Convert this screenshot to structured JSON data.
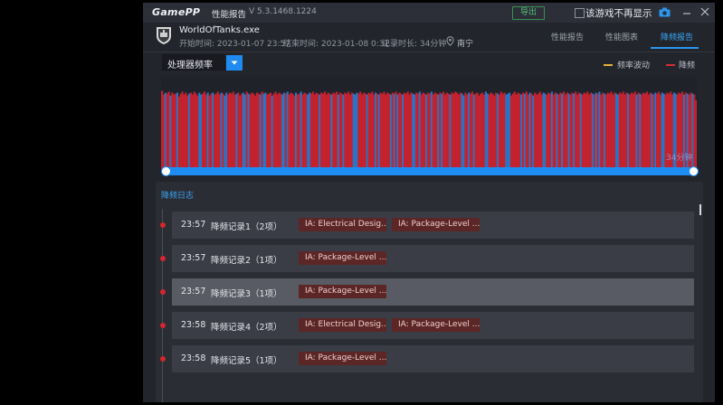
{
  "window": {
    "logo": "GamePP",
    "title": "性能报告",
    "version": "V 5.3.1468.1224",
    "export_label": "导出",
    "no_show_label": "该游戏不再显示"
  },
  "header": {
    "exe_name": "WorldOfTanks.exe",
    "start_time": "开始时间: 2023-01-07 23:57",
    "end_time": "结束时间: 2023-01-08 0:31",
    "duration": "记录时长: 34分钟",
    "city": "南宁",
    "tabs": [
      {
        "label": "性能报告",
        "active": false
      },
      {
        "label": "性能图表",
        "active": false
      },
      {
        "label": "降频报告",
        "active": true
      }
    ]
  },
  "chart_controls": {
    "metric_select": "处理器频率",
    "legend": [
      {
        "label": "频率波动",
        "color": "#e3b23a"
      },
      {
        "label": "降频",
        "color": "#d03036"
      }
    ]
  },
  "chart_data": {
    "type": "bar",
    "title": "",
    "xlabel": "",
    "ylabel": "",
    "duration_label": "34分钟",
    "series": [
      {
        "name": "频率波动",
        "color": "#2c73c4"
      },
      {
        "name": "降频",
        "color": "#c2232e"
      }
    ],
    "values": [
      0.82,
      0.78,
      0.8,
      0.79,
      0.81,
      0.77,
      0.8,
      0.78,
      0.79,
      0.8,
      0.76,
      0.79,
      0.81,
      0.78,
      0.8,
      0.77,
      0.79,
      0.8,
      0.78,
      0.81,
      0.79,
      0.77,
      0.8,
      0.78,
      0.79,
      0.81,
      0.78,
      0.8,
      0.77,
      0.79,
      0.8,
      0.78,
      0.79,
      0.81,
      0.78,
      0.8,
      0.79,
      0.77,
      0.8,
      0.78,
      0.8,
      0.79,
      0.81,
      0.78,
      0.79,
      0.8,
      0.77,
      0.79,
      0.8,
      0.78,
      0.81,
      0.79,
      0.78,
      0.8,
      0.79,
      0.77,
      0.8,
      0.79,
      0.78,
      0.81,
      0.79,
      0.8,
      0.78,
      0.79,
      0.8,
      0.77,
      0.79,
      0.81,
      0.78,
      0.8,
      0.79,
      0.78,
      0.8,
      0.79,
      0.81,
      0.78,
      0.8,
      0.79,
      0.77,
      0.8,
      0.78,
      0.79,
      0.81,
      0.78,
      0.8,
      0.79,
      0.78,
      0.8,
      0.79,
      0.81,
      0.78,
      0.8,
      0.79,
      0.78,
      0.8,
      0.79,
      0.81,
      0.78,
      0.8,
      0.79,
      0.78,
      0.8,
      0.79,
      0.81,
      0.78,
      0.8,
      0.79,
      0.78,
      0.8,
      0.79,
      0.81,
      0.78,
      0.8,
      0.79,
      0.78,
      0.8,
      0.79,
      0.81,
      0.78,
      0.8,
      0.79,
      0.78,
      0.8,
      0.79,
      0.81,
      0.78,
      0.8,
      0.79,
      0.78,
      0.8,
      0.79,
      0.81,
      0.78,
      0.8,
      0.79,
      0.78,
      0.8,
      0.79,
      0.81,
      0.78,
      0.8,
      0.79,
      0.78,
      0.8,
      0.79,
      0.81,
      0.78,
      0.8,
      0.79,
      0.78,
      0.8,
      0.79,
      0.81,
      0.78,
      0.8,
      0.79,
      0.78,
      0.8,
      0.79,
      0.81,
      0.78,
      0.8,
      0.79,
      0.78,
      0.8,
      0.79,
      0.81,
      0.78,
      0.8,
      0.79,
      0.78,
      0.8,
      0.79,
      0.81,
      0.8,
      0.78,
      0.8,
      0.79,
      0.77,
      0.8,
      0.78,
      0.8,
      0.79,
      0.81,
      0.78,
      0.79,
      0.8,
      0.77,
      0.79,
      0.8,
      0.78,
      0.81,
      0.79,
      0.78,
      0.8,
      0.79,
      0.77,
      0.8,
      0.79,
      0.78,
      0.81,
      0.79,
      0.8,
      0.78,
      0.79,
      0.8,
      0.77,
      0.79,
      0.81,
      0.78,
      0.8,
      0.79,
      0.78,
      0.8,
      0.79,
      0.81,
      0.78,
      0.8,
      0.79,
      0.77,
      0.8,
      0.78,
      0.79,
      0.81,
      0.78,
      0.8,
      0.79,
      0.78,
      0.8,
      0.79,
      0.81,
      0.78,
      0.8,
      0.79,
      0.78,
      0.8,
      0.79,
      0.81,
      0.78,
      0.8,
      0.79,
      0.78,
      0.8,
      0.79,
      0.81,
      0.78,
      0.8,
      0.79,
      0.78,
      0.8,
      0.79,
      0.81,
      0.78,
      0.8,
      0.79,
      0.78,
      0.8,
      0.79,
      0.81,
      0.78,
      0.8,
      0.79,
      0.78,
      0.8,
      0.79,
      0.81,
      0.78,
      0.8,
      0.79,
      0.78,
      0.8,
      0.79,
      0.81,
      0.78,
      0.8,
      0.79,
      0.78,
      0.8,
      0.79,
      0.81,
      0.78,
      0.8,
      0.79,
      0.78,
      0.8,
      0.79,
      0.81,
      0.78,
      0.8,
      0.79,
      0.78,
      0.8,
      0.79,
      0.81,
      0.78,
      0.8,
      0.79,
      0.78,
      0.8,
      0.79,
      0.81,
      0.78,
      0.8,
      0.79,
      0.78,
      0.8,
      0.79,
      0.81,
      0.78,
      0.8,
      0.79,
      0.78,
      0.8,
      0.79,
      0.78,
      0.72
    ],
    "ylim": [
      0,
      1
    ]
  },
  "log": {
    "title": "降频日志",
    "entries": [
      {
        "time": "23:57",
        "name": "降频记录1（2项）",
        "tags": [
          "IA: Electrical Desig...",
          "IA: Package-Level ..."
        ],
        "highlight": false
      },
      {
        "time": "23:57",
        "name": "降频记录2（1项）",
        "tags": [
          "IA: Package-Level ..."
        ],
        "highlight": false
      },
      {
        "time": "23:57",
        "name": "降频记录3（1项）",
        "tags": [
          "IA: Package-Level ..."
        ],
        "highlight": true
      },
      {
        "time": "23:58",
        "name": "降频记录4（2项）",
        "tags": [
          "IA: Electrical Desig...",
          "IA: Package-Level ..."
        ],
        "highlight": false
      },
      {
        "time": "23:58",
        "name": "降频记录5（1项）",
        "tags": [
          "IA: Package-Level ..."
        ],
        "highlight": false
      }
    ]
  }
}
